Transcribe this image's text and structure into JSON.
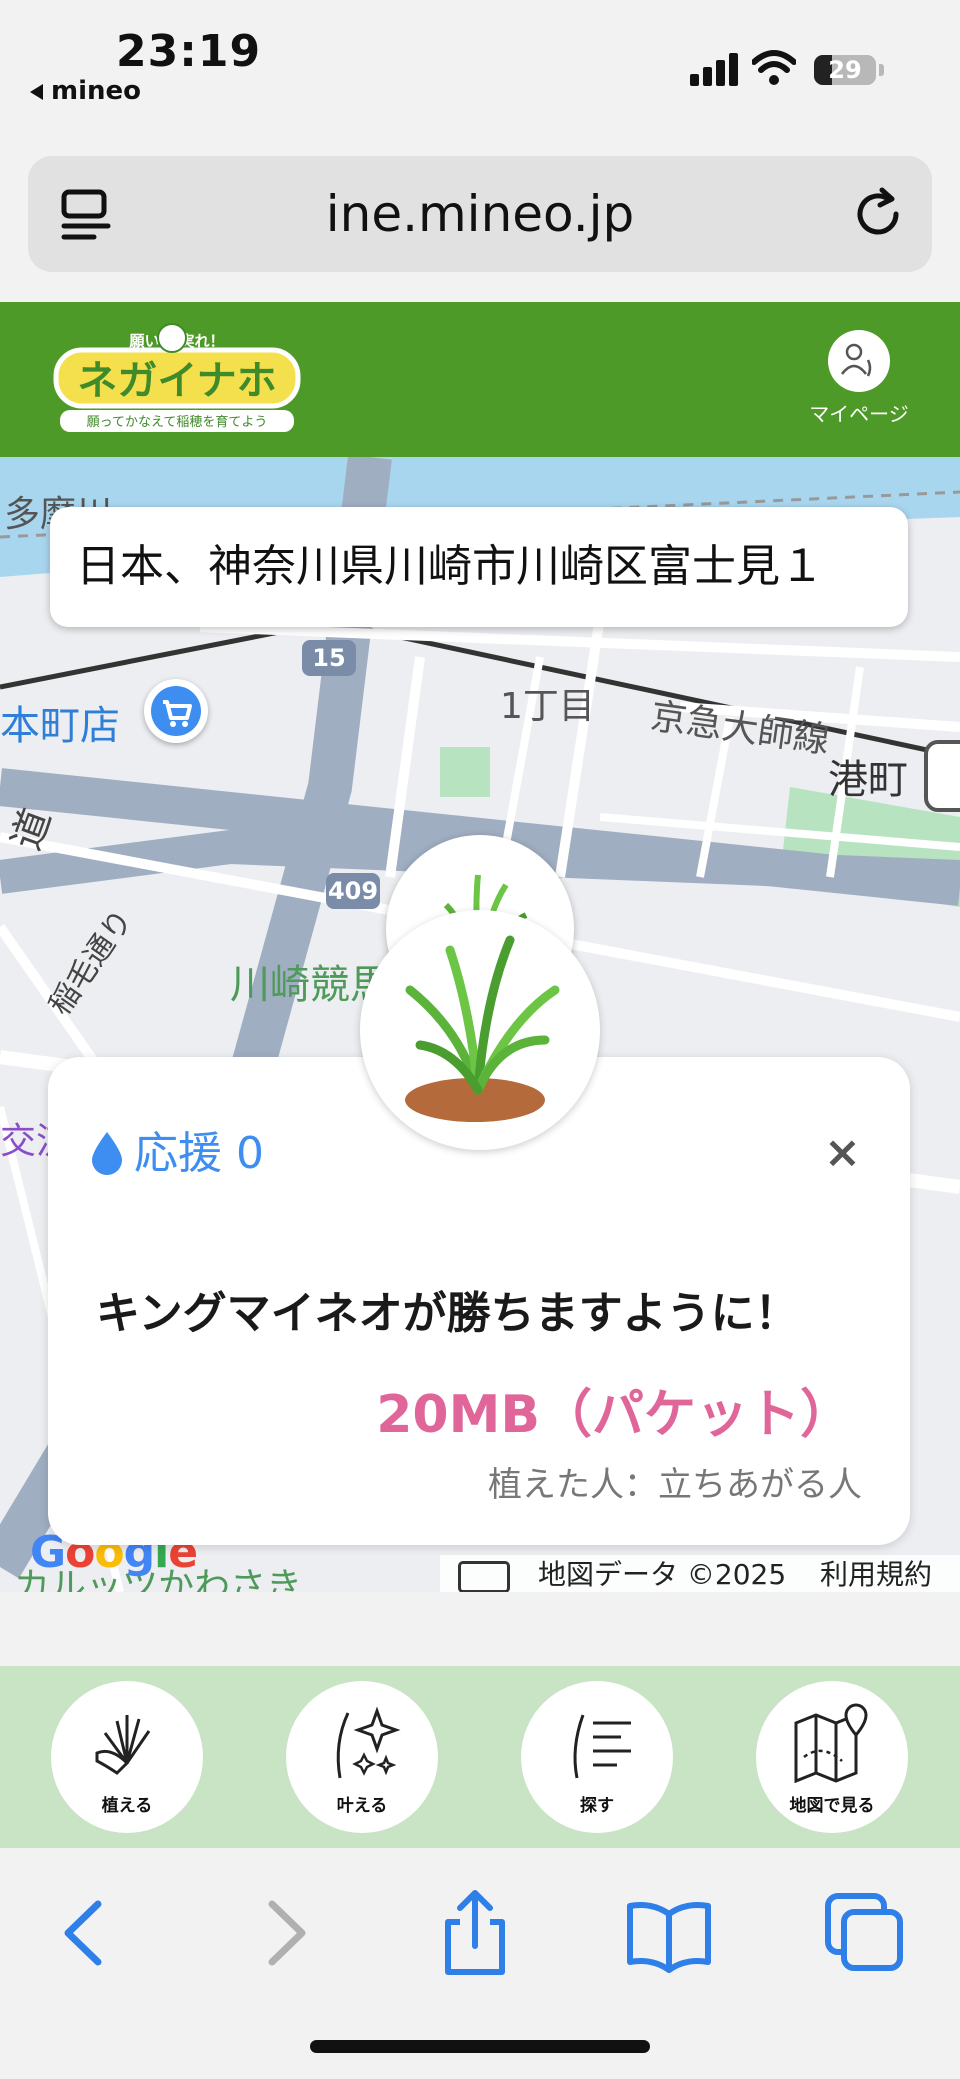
{
  "status_bar": {
    "time": "23:19",
    "back_app": "mineo",
    "battery": "29",
    "battery_level": 0.29
  },
  "browser": {
    "url": "ine.mineo.jp",
    "tabs_icon": "tabs-list-icon",
    "reload_icon": "reload-icon"
  },
  "header": {
    "logo_text_top": "願いよ 実れ！",
    "logo_text_main": "ネガイナホ",
    "logo_text_sub": "願ってかなえて稲穂を育てよう",
    "mypage_label": "マイページ"
  },
  "map": {
    "address": "日本、神奈川県川崎市川崎区富士見１",
    "labels": {
      "river": "多摩川",
      "shop": "本町店",
      "chome": "1丁目",
      "rail": "京急大師線",
      "station": "港町",
      "street": "稲毛通り",
      "race": "川崎競馬",
      "road_side": "道",
      "koryu": "交流",
      "bottom": "カルッツかわさき"
    },
    "route_15": "15",
    "route_409": "409",
    "google": [
      "G",
      "o",
      "o",
      "g",
      "l",
      "e"
    ],
    "map_data": "地図データ ©2025",
    "terms": "利用規約"
  },
  "card": {
    "support_label": "応援 0",
    "close_symbol": "×",
    "wish": "キングマイネオが勝ちますように！",
    "reward": "20MB（パケット）",
    "planter": "植えた人：立ちあがる人"
  },
  "app_nav": {
    "plant": "植える",
    "grant": "叶える",
    "search": "探す",
    "map_view": "地図で見る"
  },
  "colors": {
    "header_green": "#4e9a29",
    "accent_blue": "#3d8ef0",
    "reward_pink": "#e0669a",
    "nav_green": "#c9e3c5"
  }
}
